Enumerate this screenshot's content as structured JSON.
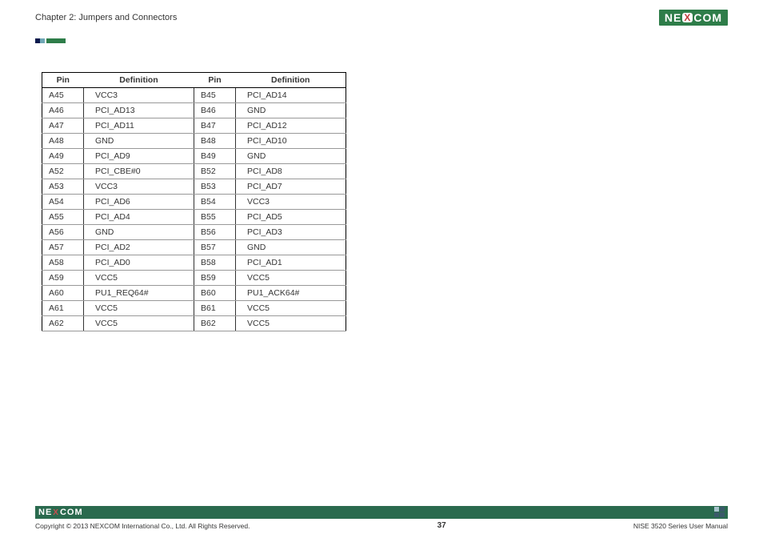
{
  "header": {
    "chapter_title": "Chapter 2: Jumpers and Connectors",
    "logo_text_left": "NE",
    "logo_text_x": "X",
    "logo_text_right": "COM"
  },
  "pin_table": {
    "columns": [
      "Pin",
      "Definition",
      "Pin",
      "Definition"
    ],
    "rows": [
      [
        "A45",
        "VCC3",
        "B45",
        "PCI_AD14"
      ],
      [
        "A46",
        "PCI_AD13",
        "B46",
        "GND"
      ],
      [
        "A47",
        "PCI_AD11",
        "B47",
        "PCI_AD12"
      ],
      [
        "A48",
        "GND",
        "B48",
        "PCI_AD10"
      ],
      [
        "A49",
        "PCI_AD9",
        "B49",
        "GND"
      ],
      [
        "A52",
        "PCI_CBE#0",
        "B52",
        "PCI_AD8"
      ],
      [
        "A53",
        "VCC3",
        "B53",
        "PCI_AD7"
      ],
      [
        "A54",
        "PCI_AD6",
        "B54",
        "VCC3"
      ],
      [
        "A55",
        "PCI_AD4",
        "B55",
        "PCI_AD5"
      ],
      [
        "A56",
        "GND",
        "B56",
        "PCI_AD3"
      ],
      [
        "A57",
        "PCI_AD2",
        "B57",
        "GND"
      ],
      [
        "A58",
        "PCI_AD0",
        "B58",
        "PCI_AD1"
      ],
      [
        "A59",
        "VCC5",
        "B59",
        "VCC5"
      ],
      [
        "A60",
        "PU1_REQ64#",
        "B60",
        "PU1_ACK64#"
      ],
      [
        "A61",
        "VCC5",
        "B61",
        "VCC5"
      ],
      [
        "A62",
        "VCC5",
        "B62",
        "VCC5"
      ]
    ]
  },
  "footer": {
    "logo_text_left": "NE",
    "logo_text_x": "X",
    "logo_text_right": "COM",
    "copyright": "Copyright © 2013 NEXCOM International Co., Ltd. All Rights Reserved.",
    "page_number": "37",
    "manual_name": "NISE 3520 Series User Manual"
  }
}
